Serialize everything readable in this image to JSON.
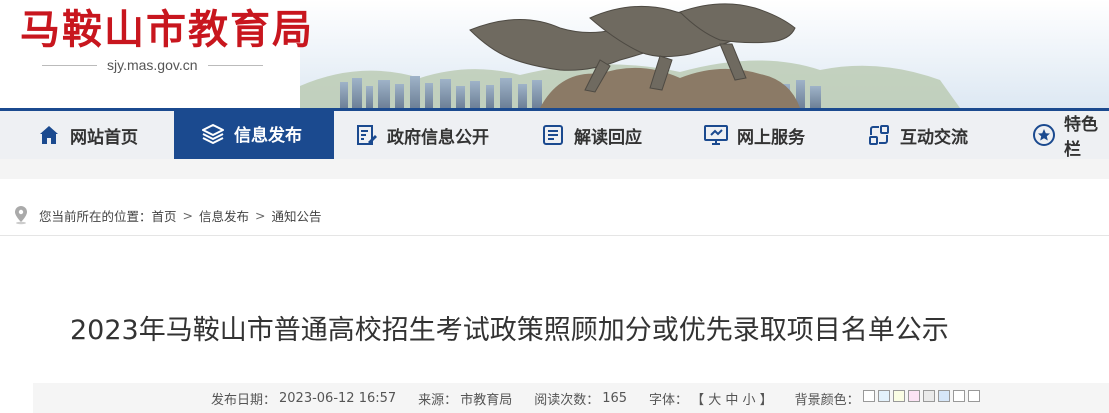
{
  "header": {
    "site_name": "马鞍山市教育局",
    "site_url": "sjy.mas.gov.cn"
  },
  "nav": {
    "items": [
      {
        "label": "网站首页",
        "icon": "home-icon"
      },
      {
        "label": "信息发布",
        "icon": "layers-icon",
        "active": true
      },
      {
        "label": "政府信息公开",
        "icon": "document-edit-icon"
      },
      {
        "label": "解读回应",
        "icon": "list-doc-icon"
      },
      {
        "label": "网上服务",
        "icon": "monitor-icon"
      },
      {
        "label": "互动交流",
        "icon": "interaction-icon"
      },
      {
        "label": "特色栏",
        "icon": "star-circle-icon"
      }
    ]
  },
  "breadcrumb": {
    "prefix": "您当前所在的位置：",
    "items": [
      "首页",
      "信息发布",
      "通知公告"
    ],
    "separator": ">"
  },
  "article": {
    "title": "2023年马鞍山市普通高校招生考试政策照顾加分或优先录取项目名单公示",
    "publish_label": "发布日期：",
    "publish_date": "2023-06-12 16:57",
    "source_label": "来源：",
    "source": "市教育局",
    "views_label": "阅读次数：",
    "views": "165",
    "font_label": "字体：",
    "font_options": "【 大 中 小 】",
    "bg_label": "背景颜色：",
    "bg_colors": [
      "#ffffff",
      "#e3f1fb",
      "#fafde4",
      "#fbe3f4",
      "#eaeaea",
      "#d6e6f8",
      "#ffffff",
      "#ffffff"
    ]
  },
  "colors": {
    "brand_red": "#c8161e",
    "nav_blue": "#1b4a8f",
    "nav_bg": "#eef0f3"
  }
}
